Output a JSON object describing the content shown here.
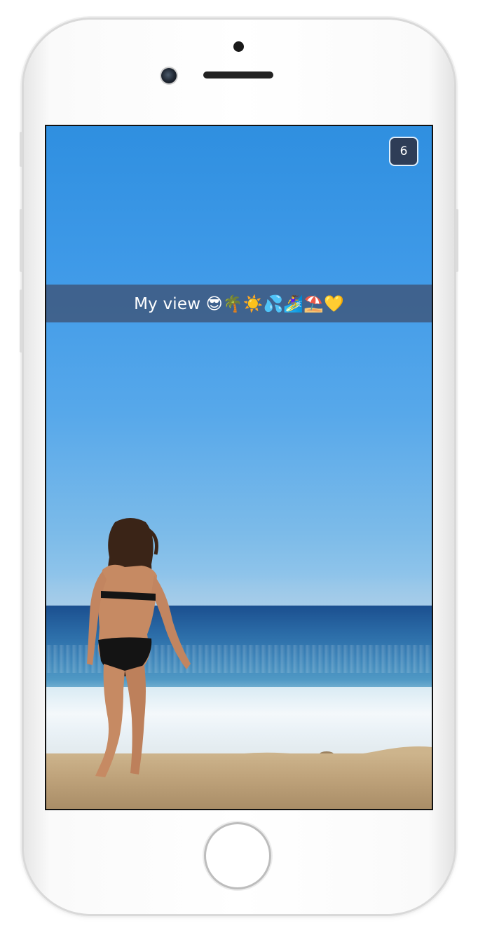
{
  "snap": {
    "caption": "My view 😎🌴☀️💦🏄‍♀️⛱️💛",
    "timer": "6"
  },
  "icons": {
    "camera": "front-camera-icon",
    "home": "home-button-icon"
  },
  "colors": {
    "caption_bar": "#3e567a",
    "timer_badge": "#2e3d57",
    "sky": "#3f9ae8",
    "ocean": "#2a6aa6",
    "sand": "#bea27a"
  }
}
